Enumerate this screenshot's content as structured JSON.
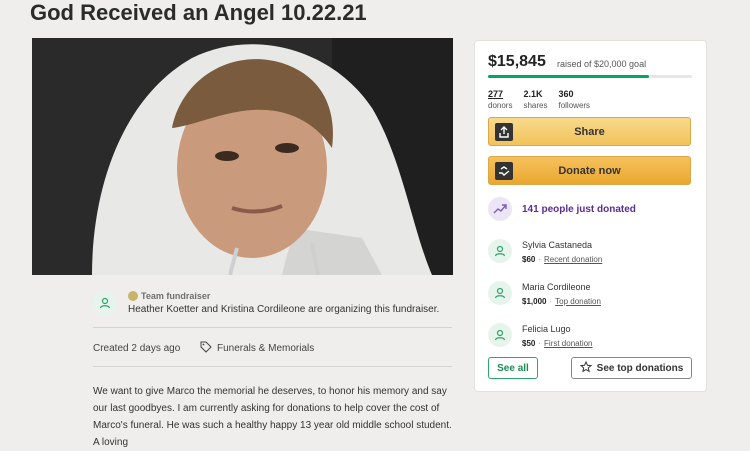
{
  "page": {
    "title": "God Received an Angel 10.22.21"
  },
  "campaign": {
    "amount_raised": "$15,845",
    "goal_text": "raised of $20,000 goal",
    "progress_fraction": 0.79,
    "stats": [
      {
        "value": "277",
        "label": "donors"
      },
      {
        "value": "2.1K",
        "label": "shares"
      },
      {
        "value": "360",
        "label": "followers"
      }
    ],
    "share_label": "Share",
    "donate_label": "Donate now",
    "recent_label": "141 people just donated",
    "donations": [
      {
        "name": "Sylvia Castaneda",
        "amount": "$60",
        "tag": "Recent donation"
      },
      {
        "name": "Maria Cordileone",
        "amount": "$1,000",
        "tag": "Top donation"
      },
      {
        "name": "Felicia Lugo",
        "amount": "$50",
        "tag": "First donation"
      }
    ],
    "see_all_label": "See all",
    "see_top_label": "See top donations"
  },
  "organizer": {
    "team_label": "Team fundraiser",
    "text": "Heather Koetter and Kristina Cordileone are organizing this fundraiser."
  },
  "details": {
    "created": "Created 2 days ago",
    "category": "Funerals & Memorials"
  },
  "story": {
    "text": "We want to give Marco the memorial he deserves, to honor his memory and say our last goodbyes. I am currently asking for donations to help cover the cost of Marco's funeral. He was such a healthy happy 13 year old middle school student. A loving"
  },
  "colors": {
    "accent_green": "#02a95c",
    "button_gold": "#f2c35a",
    "recent_purple": "#5a2d91"
  },
  "icons": [
    "share-icon",
    "donate-icon",
    "trending-icon",
    "donor-icon",
    "tag-icon",
    "star-icon",
    "team-icon"
  ]
}
